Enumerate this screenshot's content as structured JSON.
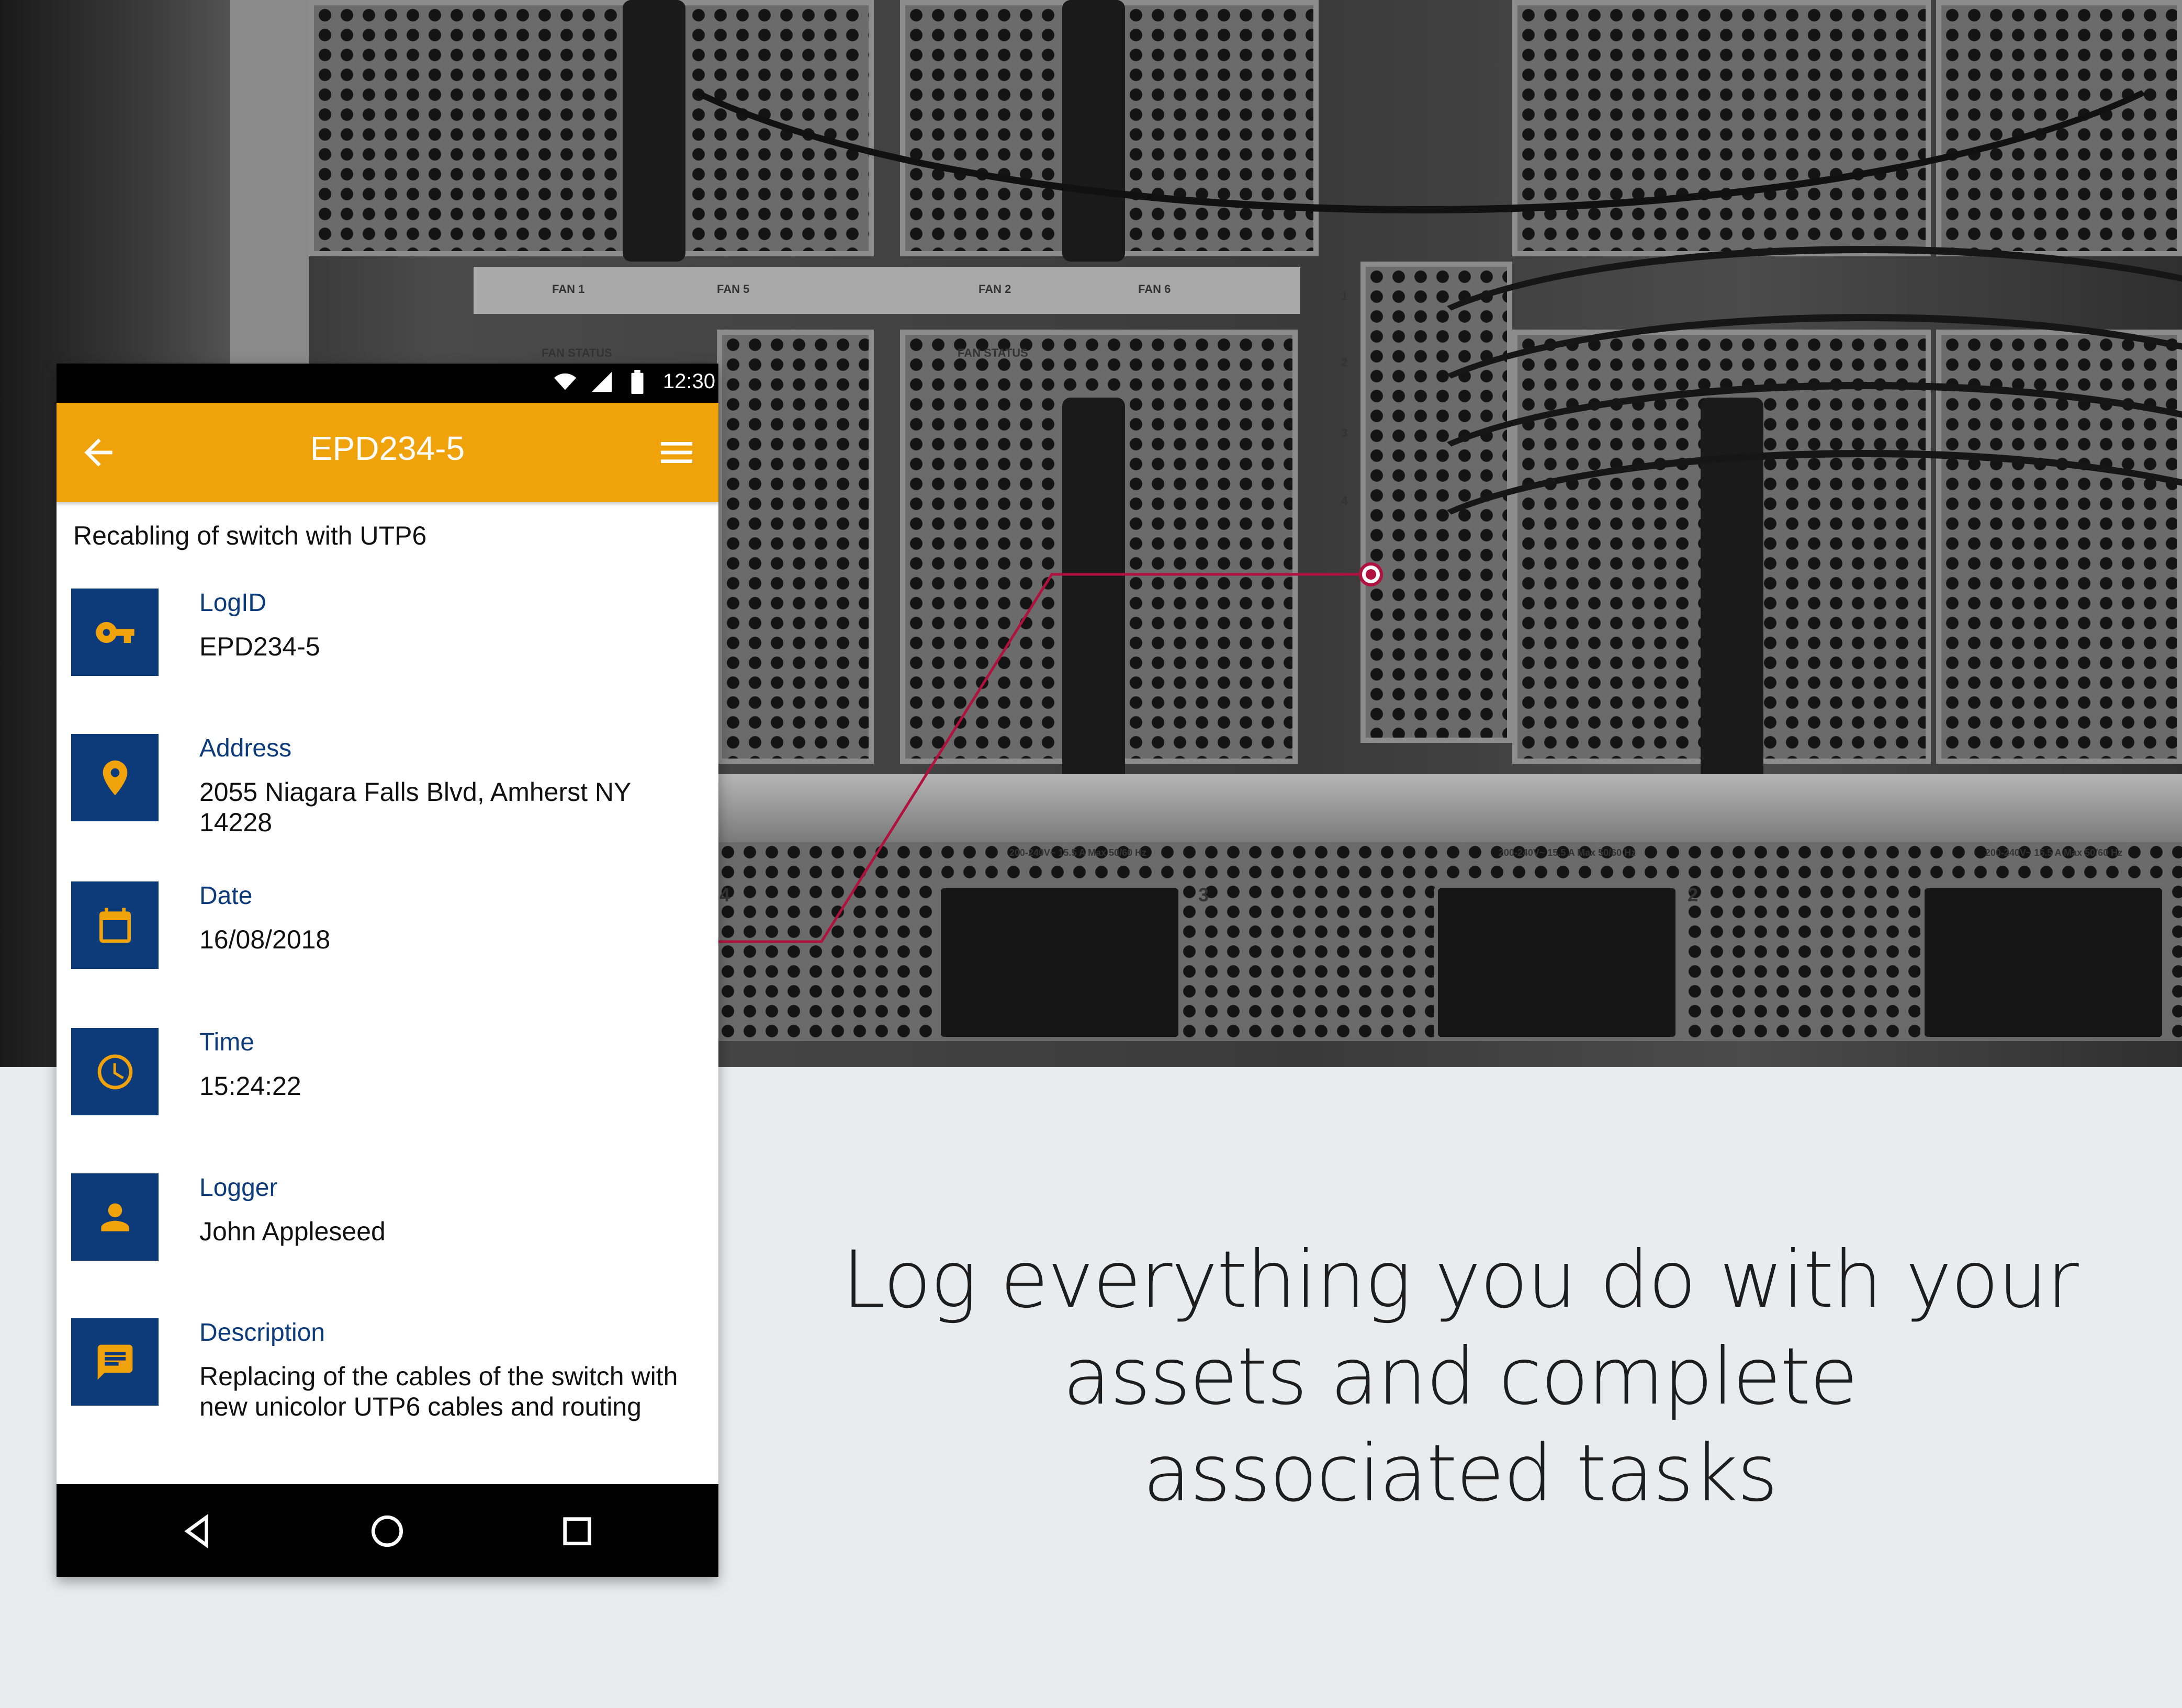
{
  "status_bar": {
    "time": "12:30",
    "icons": [
      "wifi-icon",
      "signal-icon",
      "battery-icon"
    ]
  },
  "app_bar": {
    "title": "EPD234-5",
    "back_icon": "arrow-left-icon",
    "menu_icon": "hamburger-menu-icon",
    "color": "#f0a20b"
  },
  "record": {
    "subtitle": "Recabling of switch with UTP6",
    "fields": [
      {
        "label": "LogID",
        "value": "EPD234-5",
        "icon": "key-icon"
      },
      {
        "label": "Address",
        "value": "2055 Niagara Falls Blvd, Amherst NY 14228",
        "icon": "location-pin-icon"
      },
      {
        "label": "Date",
        "value": "16/08/2018",
        "icon": "calendar-icon"
      },
      {
        "label": "Time",
        "value": "15:24:22",
        "icon": "clock-icon"
      },
      {
        "label": "Logger",
        "value": "John Appleseed",
        "icon": "person-icon"
      },
      {
        "label": "Description",
        "value": "Replacing of the cables of the switch with new unicolor UTP6 cables and routing",
        "icon": "message-icon"
      }
    ]
  },
  "nav_bar": {
    "icons": [
      "back-triangle-icon",
      "home-circle-icon",
      "recents-square-icon"
    ]
  },
  "headline": {
    "lines": [
      "Log everything you do with your",
      "assets and complete",
      "associated tasks"
    ]
  },
  "hardware_labels": {
    "fan1": "FAN 1",
    "fan5": "FAN 5",
    "fan2": "FAN 2",
    "fan6": "FAN 6",
    "fan_status": "FAN STATUS",
    "psu_rating": "200-240V~ 15.5 A Max 50/60 Hz",
    "ports": [
      "1",
      "2",
      "3",
      "4"
    ],
    "psu_numbers": [
      "4",
      "3",
      "2"
    ]
  },
  "colors": {
    "accent": "#f0a20b",
    "icon_tile": "#0d3b7a",
    "connector": "#b0123f",
    "background": "#e8ecef"
  }
}
